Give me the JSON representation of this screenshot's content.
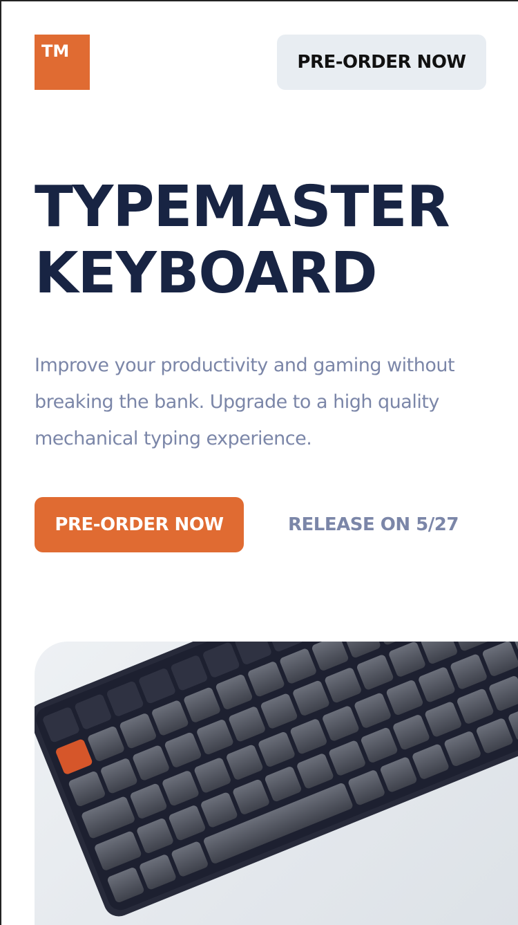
{
  "header": {
    "logo_text": "TM",
    "preorder_label": "PRE-ORDER NOW"
  },
  "hero": {
    "title_line1": "TYPEMASTER",
    "title_line2": "KEYBOARD",
    "description": "Improve your productivity and gaming without breaking the bank. Upgrade to a high quality mechanical typing experience.",
    "cta_label": "PRE-ORDER NOW",
    "release_text": "RELEASE ON 5/27"
  },
  "colors": {
    "accent": "#e06b32",
    "heading": "#182443",
    "muted": "#7b86a8",
    "secondary_button": "#e8edf2"
  },
  "image": {
    "icon": "keyboard-photo"
  }
}
